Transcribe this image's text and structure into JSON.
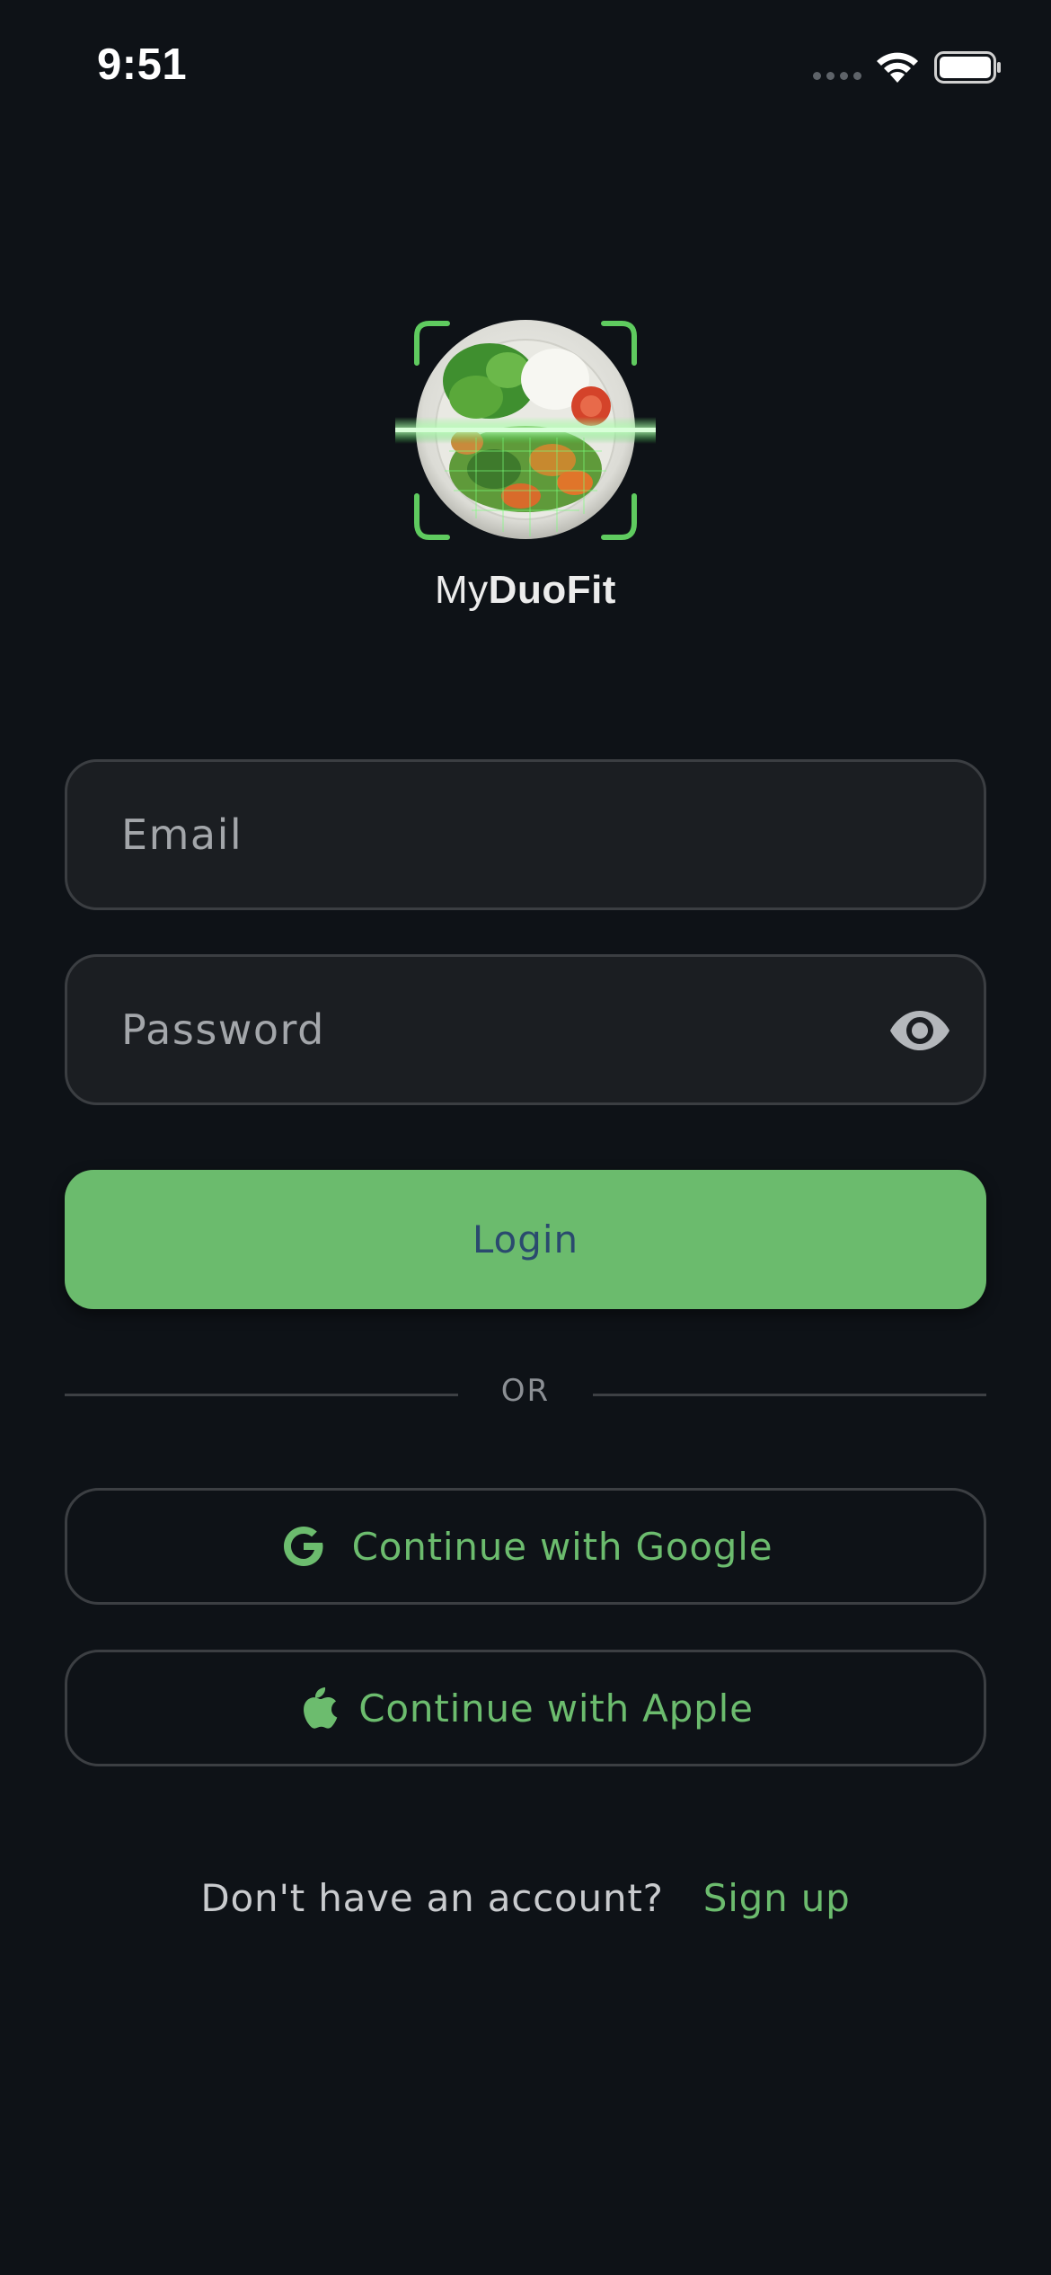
{
  "status_bar": {
    "time": "9:51",
    "icons": [
      "cellular-signal-icon",
      "wifi-icon",
      "battery-icon"
    ]
  },
  "app": {
    "logo_icon": "plate-scan-icon",
    "name_prefix": "My",
    "name_bold": "DuoFit"
  },
  "form": {
    "email_placeholder": "Email",
    "password_placeholder": "Password",
    "password_toggle_icon": "eye-icon",
    "login_label": "Login"
  },
  "divider": {
    "label": "OR"
  },
  "social": {
    "google_label": "Continue with Google",
    "google_icon": "google-icon",
    "apple_label": "Continue with Apple",
    "apple_icon": "apple-icon"
  },
  "footer": {
    "question": "Don't have an account?",
    "signup_label": "Sign up"
  },
  "colors": {
    "background": "#0e1217",
    "accent": "#6bbb6d",
    "field_background": "#1b1e22",
    "field_border": "#3b3e42",
    "login_text": "#2a4a6e"
  }
}
